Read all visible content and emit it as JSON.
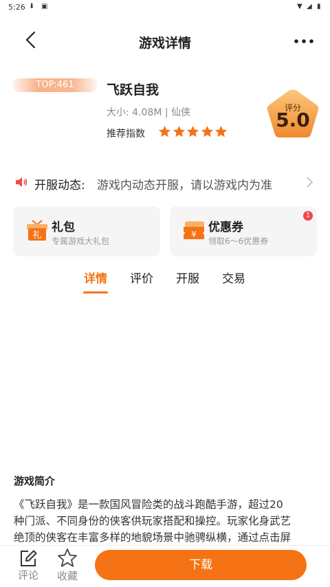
{
  "status_bar": {
    "time": "5:26"
  },
  "header": {
    "title": "游戏详情"
  },
  "game": {
    "rank_badge": "TOP:461",
    "name": "飞跃自我",
    "meta": "大小: 4.08M | 仙侠",
    "recommend_label": "推荐指数",
    "recommend_stars": 5,
    "score_label": "评分",
    "score_value": "5.0"
  },
  "notice": {
    "label": "开服动态:",
    "text": "游戏内动态开服，请以游戏内为准"
  },
  "cards": {
    "gift": {
      "title": "礼包",
      "subtitle": "专属游戏大礼包",
      "icon_char": "礼"
    },
    "coupon": {
      "title": "优惠券",
      "subtitle": "领取6～6优惠券",
      "count": "1",
      "icon_char": "¥"
    }
  },
  "tabs": [
    "详情",
    "评价",
    "开服",
    "交易"
  ],
  "intro": {
    "title": "游戏简介",
    "lines": [
      "《飞跃自我》是一款国风冒险类的战斗跑酷手游，超过20",
      "种门派、不同身份的侠客供玩家搭配和操控。玩家化身武艺",
      "绝顶的侠客在丰富多样的地貌场景中驰骋纵横，通过点击屏"
    ]
  },
  "bottom_bar": {
    "comment_label": "评论",
    "favorite_label": "收藏",
    "download_label": "下载"
  },
  "colors": {
    "accent": "#f57315",
    "badge_red": "#f0484a",
    "score_bg": "#f5a14a"
  }
}
